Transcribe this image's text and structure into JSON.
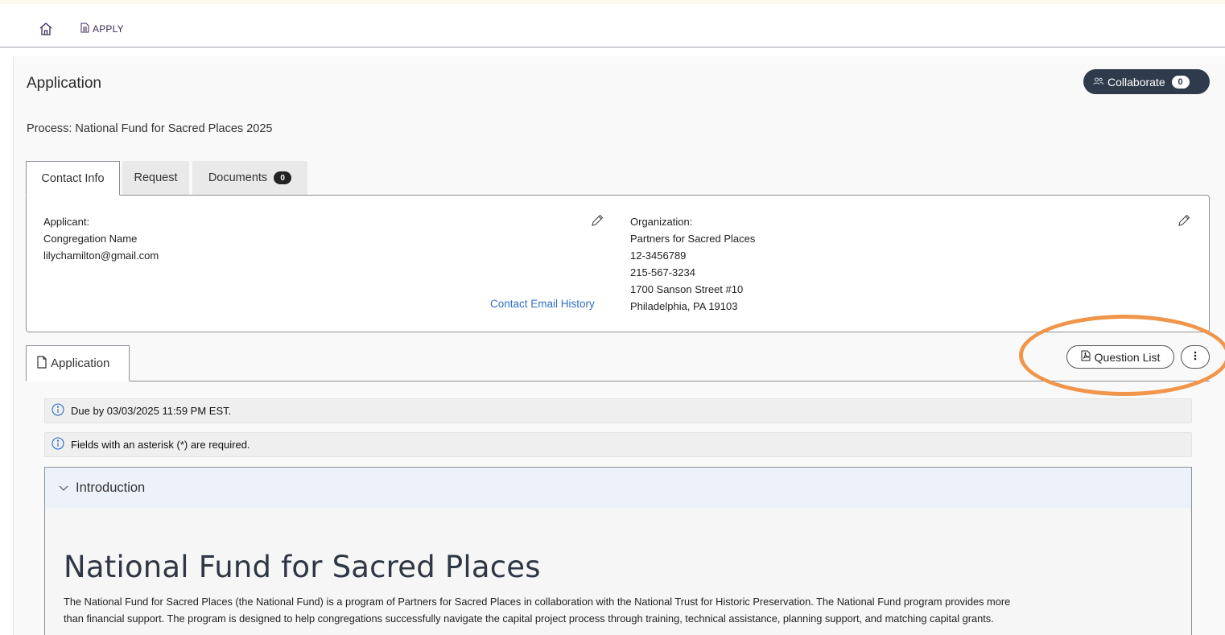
{
  "nav": {
    "apply_label": "APPLY"
  },
  "header": {
    "title": "Application",
    "collaborate_label": "Collaborate",
    "collaborate_count": "0"
  },
  "process_text": "Process: National Fund for Sacred Places 2025",
  "tabs": [
    {
      "label": "Contact Info",
      "active": true
    },
    {
      "label": "Request",
      "active": false
    },
    {
      "label": "Documents",
      "count": "0",
      "active": false
    }
  ],
  "contact": {
    "applicant_heading": "Applicant:",
    "applicant_name": "Congregation Name",
    "applicant_email": "lilychamilton@gmail.com",
    "email_history_link": "Contact Email History",
    "organization_heading": "Organization:",
    "org_name": "Partners for Sacred Places",
    "org_id": "12-3456789",
    "org_phone": "215-567-3234",
    "org_address1": "1700 Sanson Street #10",
    "org_address2": "Philadelphia, PA 19103"
  },
  "application_tab": {
    "label": "Application"
  },
  "actions": {
    "question_list_label": "Question List"
  },
  "notices": {
    "due": "Due by 03/03/2025 11:59 PM EST.",
    "required": "Fields with an asterisk (*) are required."
  },
  "intro": {
    "section_label": "Introduction",
    "heading": "National Fund for Sacred Places",
    "line1": "The National Fund for Sacred Places (the National Fund) is a program of Partners for Sacred Places in collaboration with the National Trust for Historic Preservation. The National Fund program provides more",
    "line2": "than financial support. The program is designed to help congregations successfully navigate the capital project process through training, technical assistance, planning support, and matching capital grants."
  },
  "colors": {
    "accent_dark": "#2f3b4c",
    "link_blue": "#2f6fc7",
    "highlight_orange": "#f0954a",
    "info_blue": "#2f6fc7"
  }
}
